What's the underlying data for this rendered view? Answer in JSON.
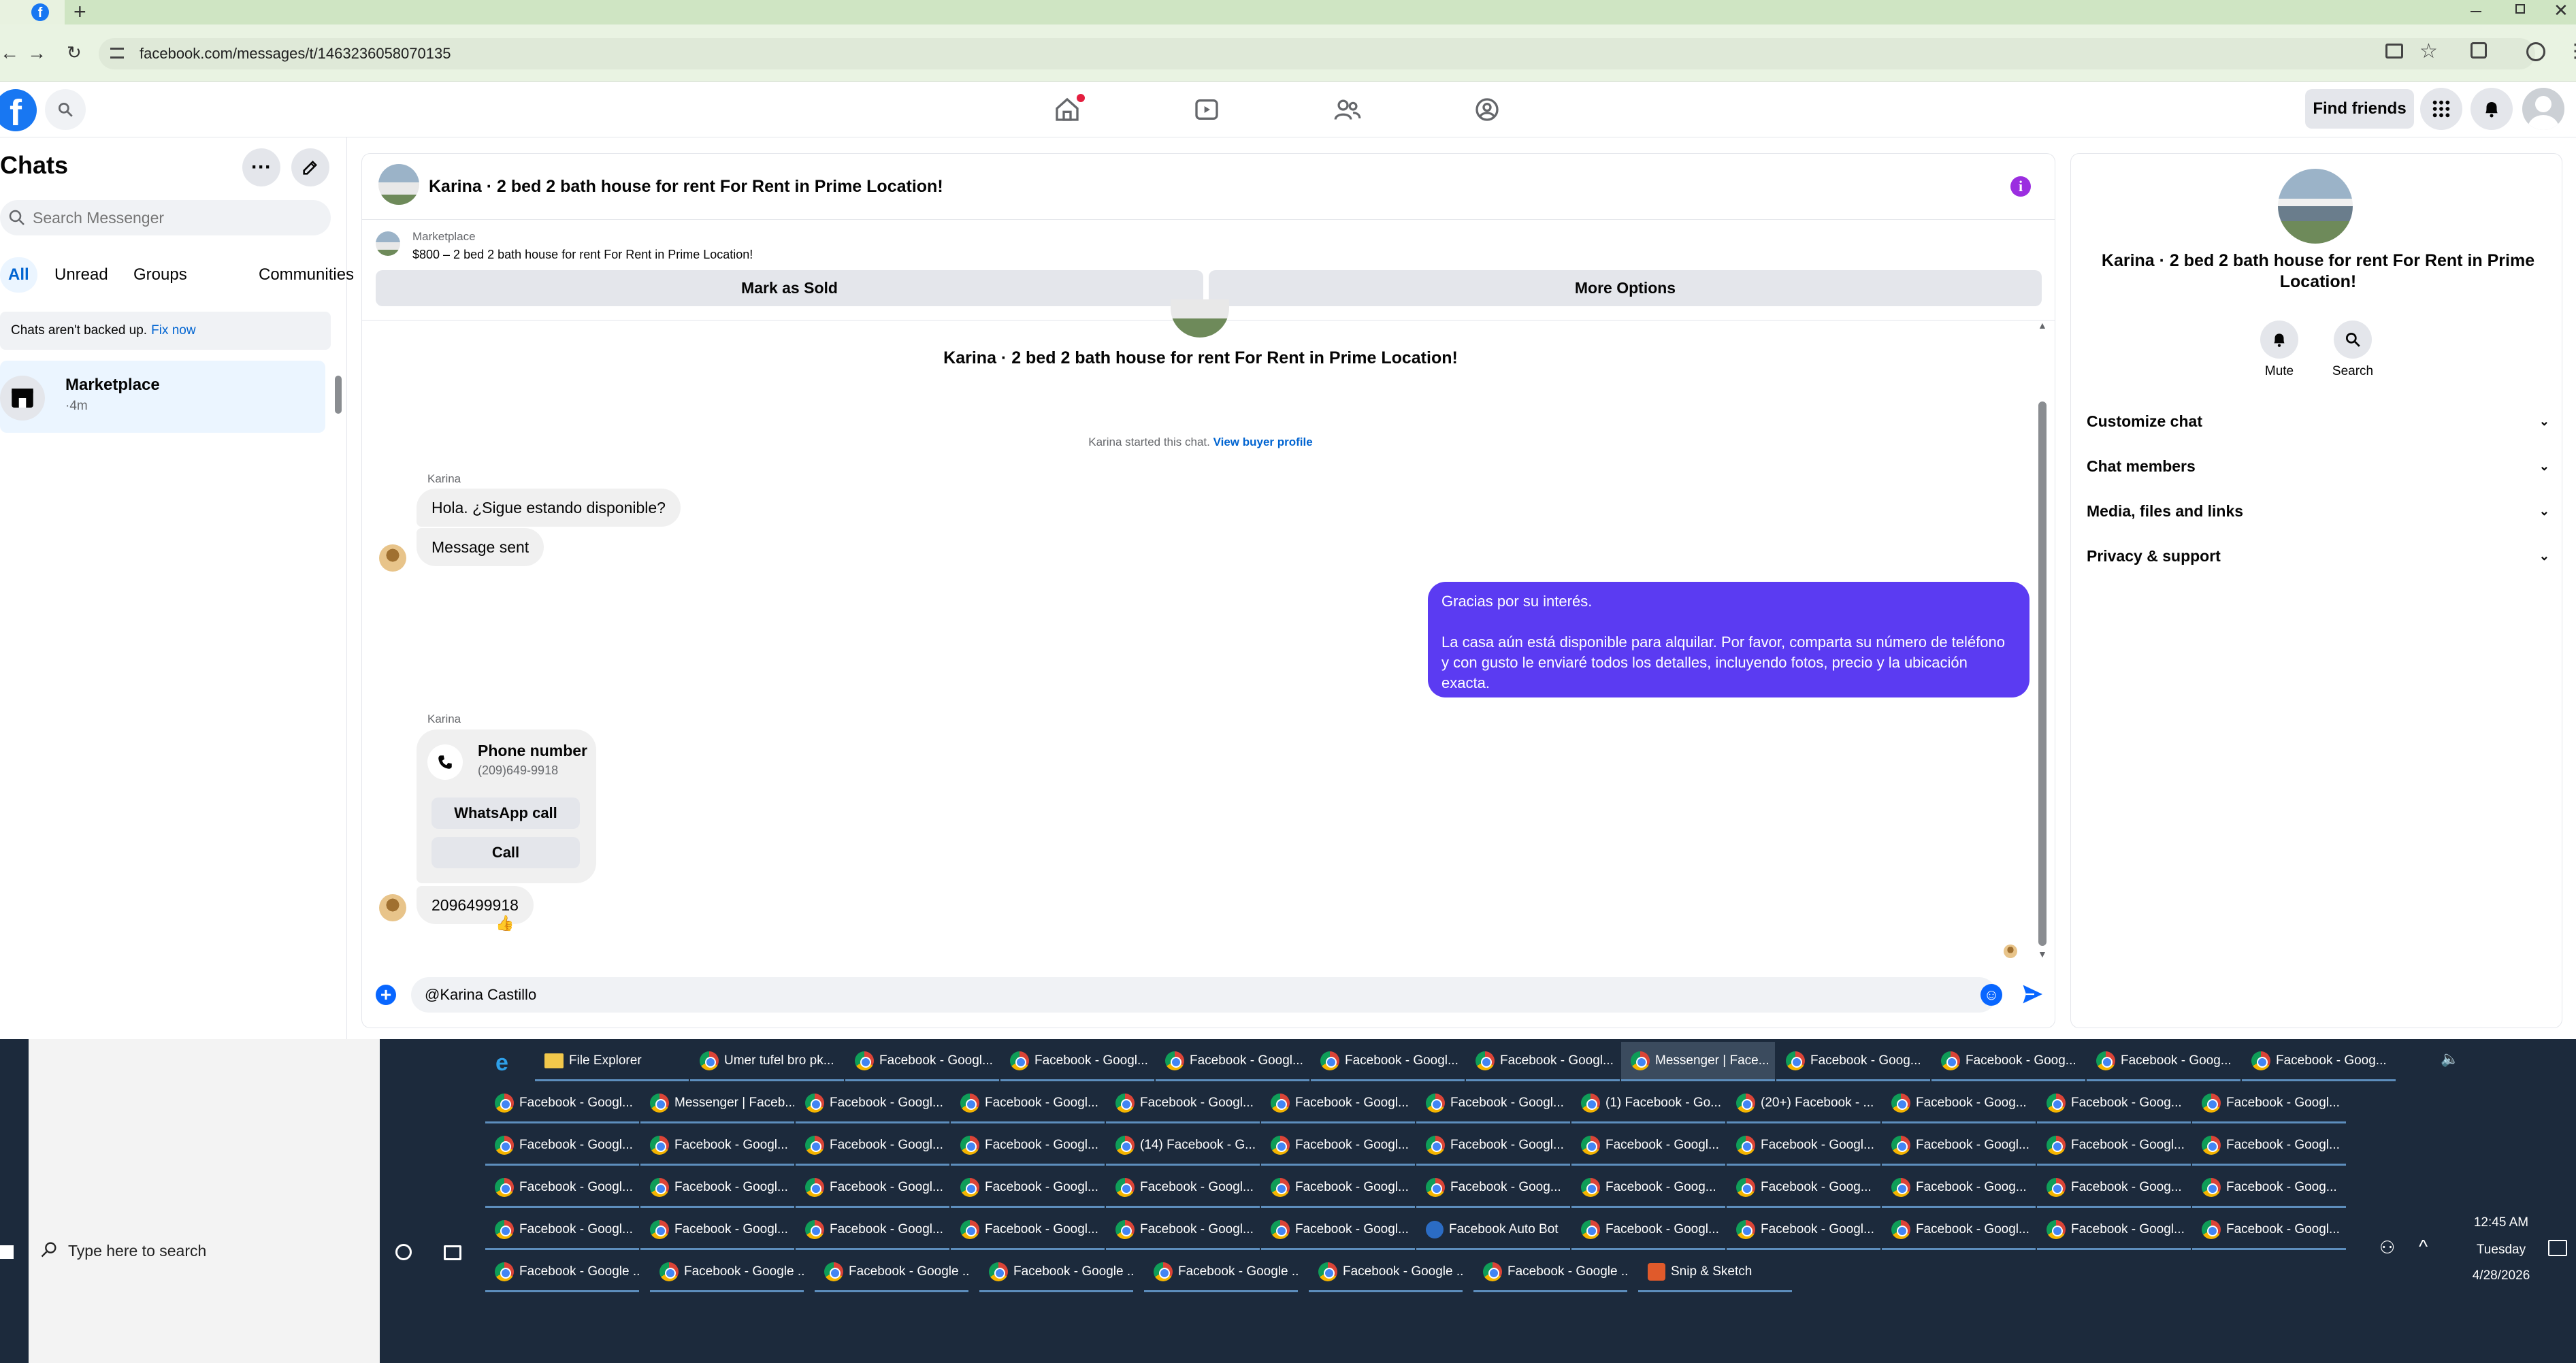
{
  "browser": {
    "url": "facebook.com/messages/t/1463236058070135",
    "tab_icon": "facebook-icon",
    "new_tab_label": "+"
  },
  "header": {
    "find_friends": "Find friends",
    "nav_icons": [
      "home-icon",
      "video-icon",
      "friends-icon",
      "gaming-icon"
    ]
  },
  "chats": {
    "title": "Chats",
    "search_placeholder": "Search Messenger",
    "filters": [
      "All",
      "Unread",
      "Groups",
      "Communities"
    ],
    "backup_notice": "Chats aren't backed up.",
    "backup_link": "Fix now",
    "items": [
      {
        "name": "Marketplace",
        "time": "·4m"
      }
    ]
  },
  "conversation": {
    "title": "Karina · 2 bed 2 bath house for rent For Rent in Prime Location!",
    "marketplace_label": "Marketplace",
    "listing": "$800 – 2 bed 2 bath house for rent For Rent in Prime Location!",
    "mark_sold": "Mark as Sold",
    "more_options": "More Options",
    "thread_title": "Karina · 2 bed 2 bath house for rent For Rent in Prime Location!",
    "started_text": "Karina started this chat.",
    "view_profile": "View buyer profile",
    "sender1": "Karina",
    "msg1": "Hola. ¿Sigue estando disponible?",
    "msg2": "Message sent",
    "outgoing_line1": "Gracias por su interés.",
    "outgoing_line2": "La casa aún está disponible para alquilar. Por favor, comparta su número de teléfono y con gusto le enviaré todos los detalles, incluyendo fotos, precio y la ubicación exacta.",
    "sender2": "Karina",
    "phone_title": "Phone number",
    "phone_value": "(209)649-9918",
    "whatsapp": "WhatsApp call",
    "call": "Call",
    "msg3": "2096499918",
    "reaction": "👍",
    "composer_value": "@Karina Castillo",
    "accent": "#5b3bf2"
  },
  "info_panel": {
    "title": "Karina · 2 bed 2 bath house for rent For Rent in Prime Location!",
    "mute": "Mute",
    "search": "Search",
    "sections": [
      "Customize chat",
      "Chat members",
      "Media, files and links",
      "Privacy & support"
    ]
  },
  "taskbar": {
    "search_placeholder": "Type here to search",
    "time": "12:45 AM",
    "day": "Tuesday",
    "date": "4/28/2026",
    "row1": [
      "File Explorer",
      "Umer tufel bro pk...",
      "Facebook - Googl...",
      "Facebook - Googl...",
      "Facebook - Googl...",
      "Facebook - Googl...",
      "Facebook - Googl...",
      "Messenger | Face...",
      "Facebook - Goog...",
      "Facebook - Goog...",
      "Facebook - Goog...",
      "Facebook - Goog..."
    ],
    "row2": [
      "Facebook - Googl...",
      "Messenger | Faceb...",
      "Facebook - Googl...",
      "Facebook - Googl...",
      "Facebook - Googl...",
      "Facebook - Googl...",
      "Facebook - Googl...",
      "(1) Facebook - Go...",
      "(20+) Facebook - ...",
      "Facebook - Goog...",
      "Facebook - Goog...",
      "Facebook - Googl..."
    ],
    "row3": [
      "Facebook - Googl...",
      "Facebook - Googl...",
      "Facebook - Googl...",
      "Facebook - Googl...",
      "(14) Facebook - G...",
      "Facebook - Googl...",
      "Facebook - Googl...",
      "Facebook - Googl...",
      "Facebook - Googl...",
      "Facebook - Googl...",
      "Facebook - Googl...",
      "Facebook - Googl..."
    ],
    "row4": [
      "Facebook - Googl...",
      "Facebook - Googl...",
      "Facebook - Googl...",
      "Facebook - Googl...",
      "Facebook - Googl...",
      "Facebook - Googl...",
      "Facebook - Goog...",
      "Facebook - Goog...",
      "Facebook - Goog...",
      "Facebook - Goog...",
      "Facebook - Goog...",
      "Facebook - Goog..."
    ],
    "row5": [
      "Facebook - Googl...",
      "Facebook - Googl...",
      "Facebook - Googl...",
      "Facebook - Googl...",
      "Facebook - Googl...",
      "Facebook - Googl...",
      "Facebook Auto Bot",
      "Facebook - Googl...",
      "Facebook - Googl...",
      "Facebook - Googl...",
      "Facebook - Googl...",
      "Facebook - Googl..."
    ],
    "row6": [
      "Facebook - Google ...",
      "Facebook - Google ...",
      "Facebook - Google ...",
      "Facebook - Google ...",
      "Facebook - Google ...",
      "Facebook - Google ...",
      "Facebook - Google ...",
      "Snip & Sketch"
    ]
  }
}
